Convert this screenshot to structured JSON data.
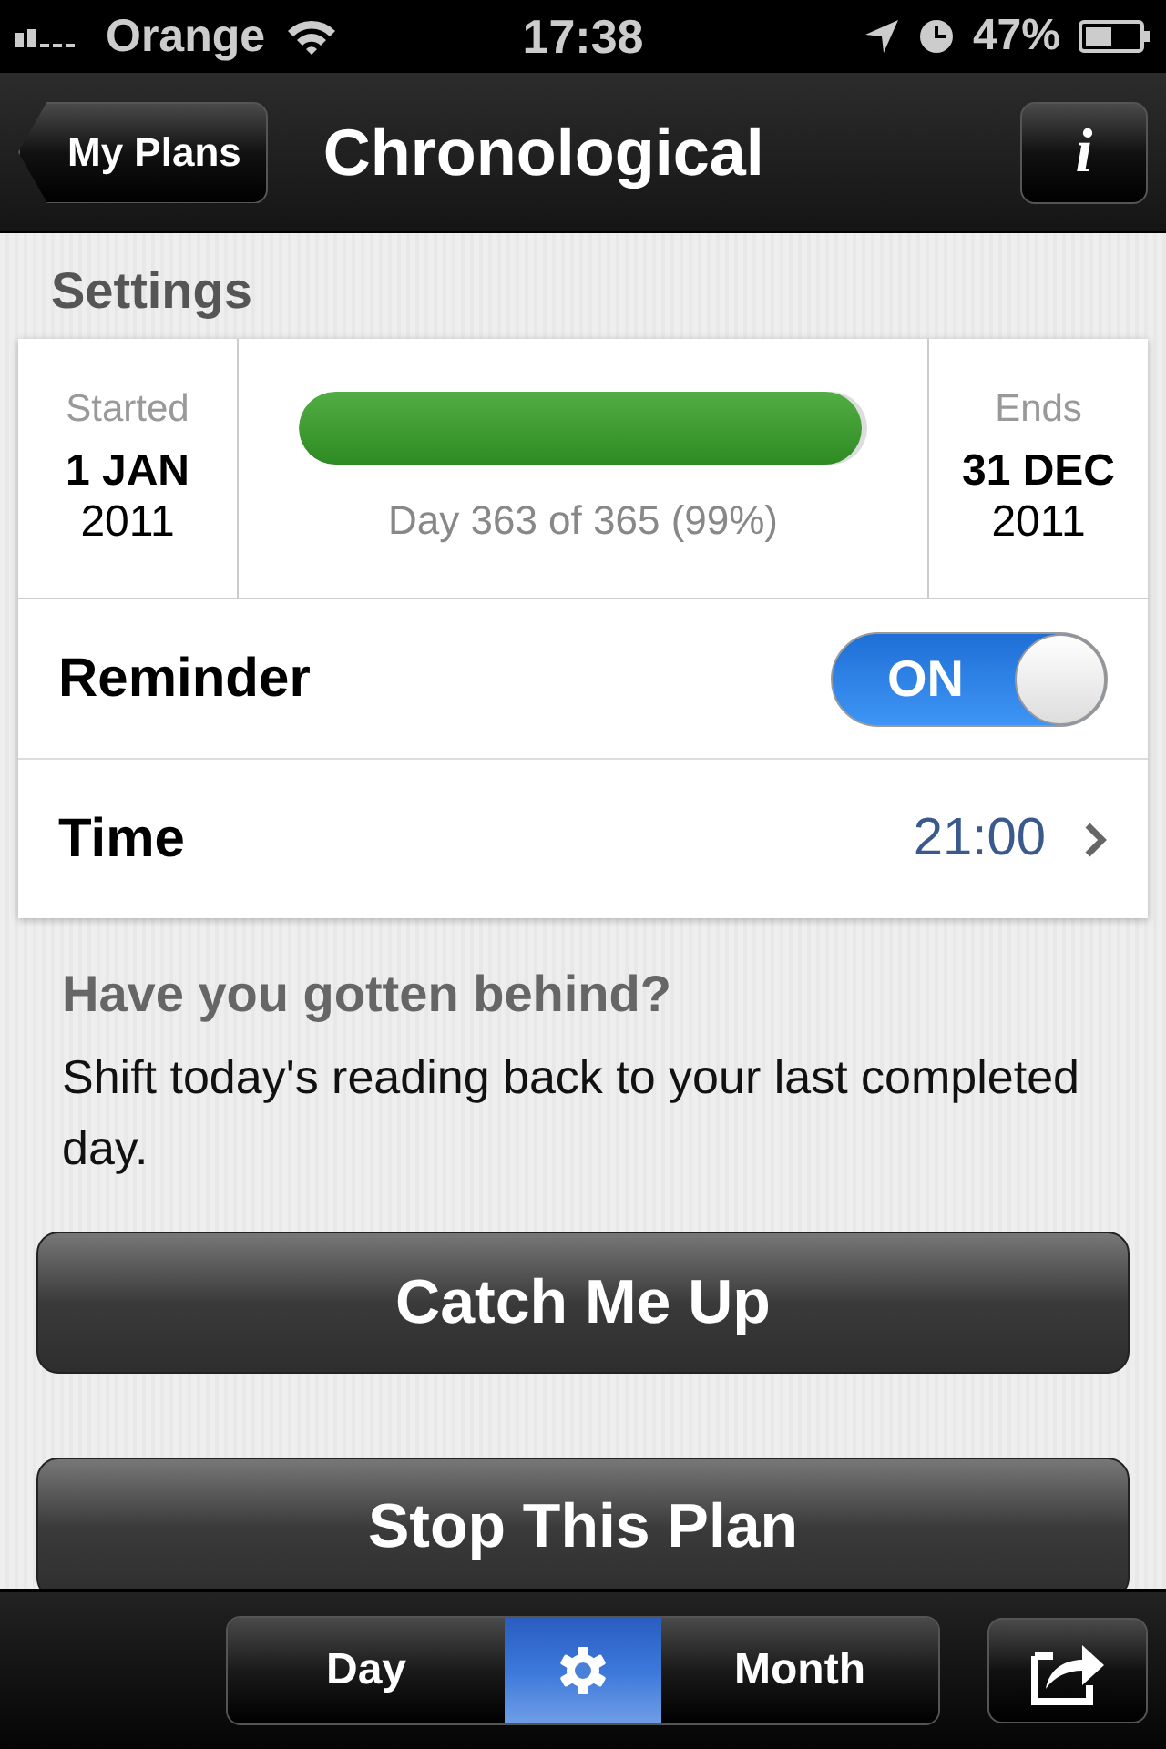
{
  "status_bar": {
    "carrier": "Orange",
    "time": "17:38",
    "battery": "47%"
  },
  "nav_bar": {
    "back_button": "My Plans",
    "title": "Chronological",
    "info_button": "i"
  },
  "section_title": "Settings",
  "plan": {
    "start_label": "Started",
    "start_date": "1 JAN",
    "start_year": "2011",
    "progress": {
      "level": 0.99,
      "caption": "Day 363 of 365 (99%)"
    },
    "end_label": "Ends",
    "end_date": "31 DEC",
    "end_year": "2011"
  },
  "reminder": {
    "label": "Reminder",
    "on": true,
    "on_text": "ON"
  },
  "time_row": {
    "label": "Time",
    "value": "21:00"
  },
  "catch_up": {
    "heading": "Have you gotten behind?",
    "text": "Shift today's reading back to your last completed day.",
    "button": "Catch Me Up"
  },
  "stop_button": "Stop This Plan",
  "tab_bar": {
    "segments": [
      {
        "kind": "text",
        "label": "Day",
        "selected": false
      },
      {
        "kind": "icon",
        "selected": true
      },
      {
        "kind": "text",
        "label": "Month",
        "selected": false
      }
    ]
  }
}
